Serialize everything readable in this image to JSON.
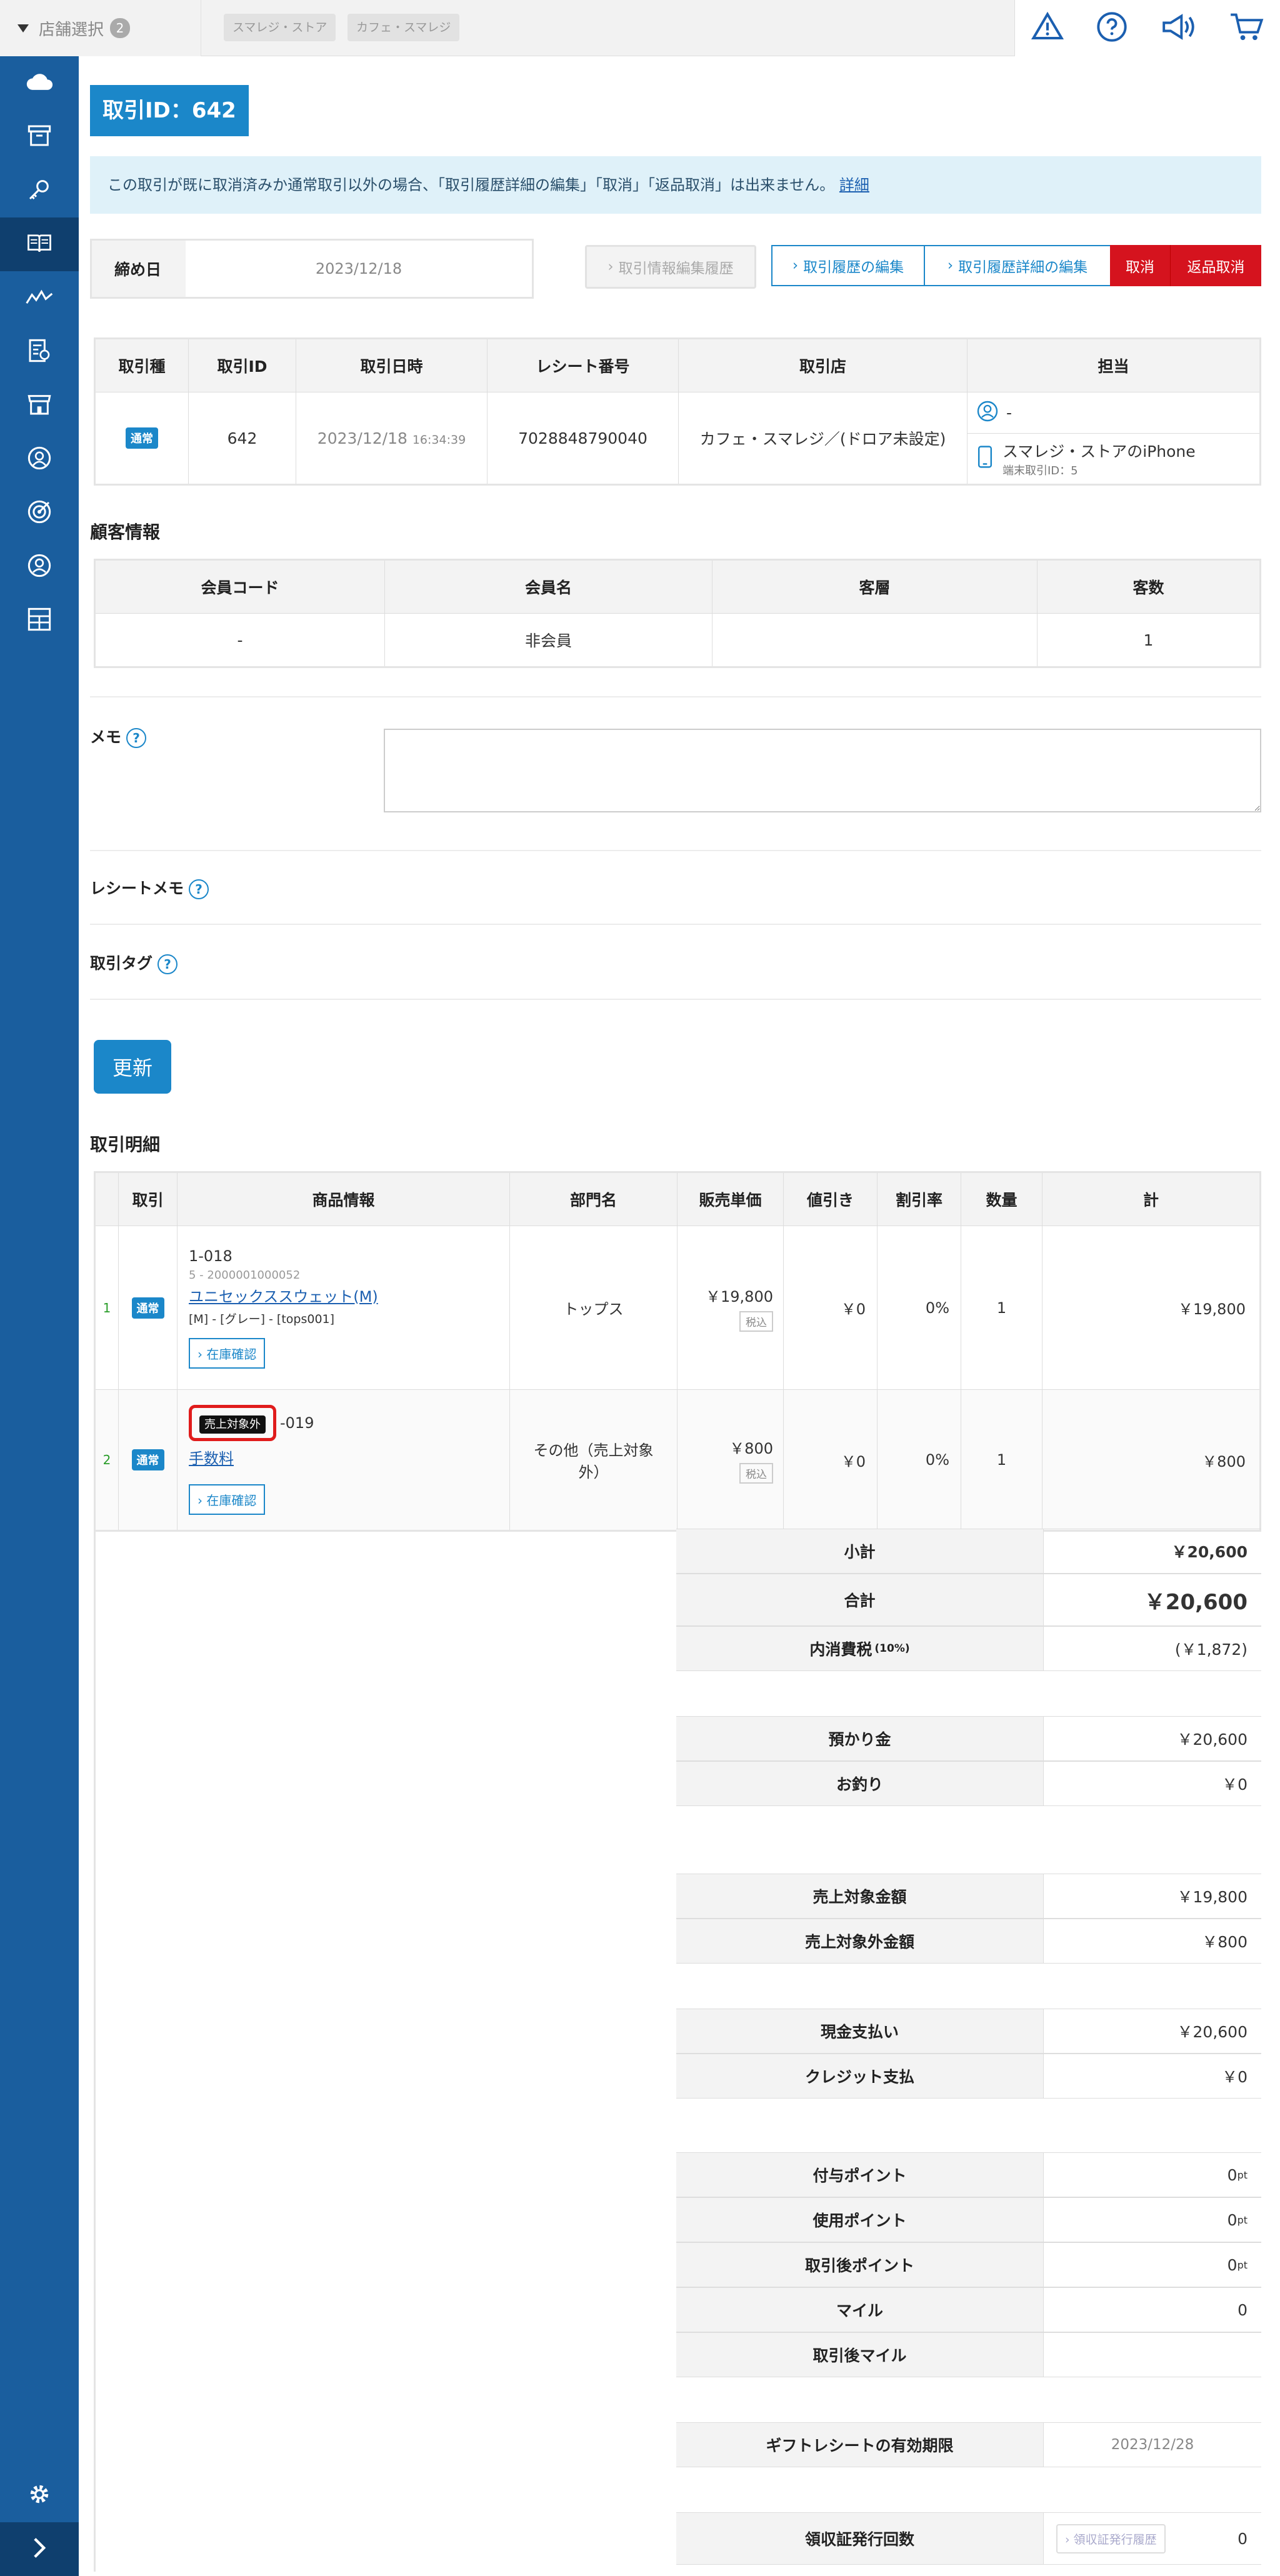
{
  "topbar": {
    "store_select_label": "店舗選択",
    "store_count": "2",
    "store_tags": [
      "スマレジ・ストア",
      "カフェ・スマレジ"
    ],
    "icons": [
      "warning-icon",
      "help-icon",
      "megaphone-icon",
      "cart-icon"
    ]
  },
  "sidebar": {
    "icons": [
      "cloud-icon",
      "archive-icon",
      "key-icon",
      "book-icon",
      "chart-line-icon",
      "report-icon",
      "store-icon",
      "customer-icon",
      "target-icon",
      "user-icon",
      "grid-icon"
    ],
    "active_index": 3,
    "bottom_icons": [
      "settings-icon",
      "chevron-right-icon"
    ]
  },
  "page": {
    "title": "取引ID：642",
    "notice_text": "この取引が既に取消済みか通常取引以外の場合、「取引履歴詳細の編集」「取消」「返品取消」は出来ません。",
    "notice_link": "詳細",
    "close_date_label": "締め日",
    "close_date_value": "2023/12/18",
    "buttons": {
      "info_edit_history": "取引情報編集履歴",
      "edit_history": "取引履歴の編集",
      "edit_history_detail": "取引履歴詳細の編集",
      "cancel": "取消",
      "return_cancel": "返品取消"
    }
  },
  "transaction": {
    "headers": [
      "取引種",
      "取引ID",
      "取引日時",
      "レシート番号",
      "取引店",
      "担当"
    ],
    "type_badge": "通常",
    "id": "642",
    "date": "2023/12/18",
    "time": "16:34:39",
    "receipt_no": "7028848790040",
    "store": "カフェ・スマレジ／(ドロア未設定)",
    "staff": "-",
    "device": "スマレジ・ストアのiPhone",
    "device_txn": "端末取引ID：5"
  },
  "customer": {
    "section_title": "顧客情報",
    "headers": [
      "会員コード",
      "会員名",
      "客層",
      "客数"
    ],
    "row": [
      "-",
      "非会員",
      "",
      "1"
    ]
  },
  "memo": {
    "label": "メモ",
    "value": ""
  },
  "receipt_memo": {
    "label": "レシートメモ"
  },
  "txn_tag": {
    "label": "取引タグ"
  },
  "update_button": "更新",
  "details": {
    "section_title": "取引明細",
    "headers": [
      "取引",
      "商品情報",
      "部門名",
      "販売単価",
      "値引き",
      "割引率",
      "数量",
      "計"
    ],
    "rows": [
      {
        "no": "1",
        "badge": "通常",
        "code": "1-018",
        "sub": "5 - 2000001000052",
        "name": "ユニセックススウェット(M)",
        "variant": "[M] - [グレー] - [tops001]",
        "stock": "在庫確認",
        "dept": "トップス",
        "price": "￥19,800",
        "tax": "税込",
        "discount": "￥0",
        "rate": "0%",
        "qty": "1",
        "total": "￥19,800"
      },
      {
        "no": "2",
        "badge": "通常",
        "code": "-019",
        "tag": "売上対象外",
        "name": "手数料",
        "stock": "在庫確認",
        "dept": "その他（売上対象外）",
        "price": "￥800",
        "tax": "税込",
        "discount": "￥0",
        "rate": "0%",
        "qty": "1",
        "total": "￥800"
      }
    ]
  },
  "summary": {
    "subtotal_label": "小計",
    "subtotal": "￥20,600",
    "total_label": "合計",
    "total": "￥20,600",
    "tax_label": "内消費税",
    "tax_rate": "(10%)",
    "tax": "(￥1,872)",
    "deposit_label": "預かり金",
    "deposit": "￥20,600",
    "change_label": "お釣り",
    "change": "￥0",
    "sales_target_label": "売上対象金額",
    "sales_target": "￥19,800",
    "non_sales_label": "売上対象外金額",
    "non_sales": "￥800",
    "cash_label": "現金支払い",
    "cash": "￥20,600",
    "credit_label": "クレジット支払",
    "credit": "￥0",
    "grant_pt_label": "付与ポイント",
    "grant_pt": "0",
    "used_pt_label": "使用ポイント",
    "used_pt": "0",
    "after_pt_label": "取引後ポイント",
    "after_pt": "0",
    "pt_unit": "pt",
    "mile_label": "マイル",
    "mile": "0",
    "after_mile_label": "取引後マイル",
    "after_mile": "",
    "gift_label": "ギフトレシートの有効期限",
    "gift": "2023/12/28",
    "receipt_issue_label": "領収証発行回数",
    "receipt_issue_btn": "領収証発行履歴",
    "receipt_issue": "0"
  }
}
